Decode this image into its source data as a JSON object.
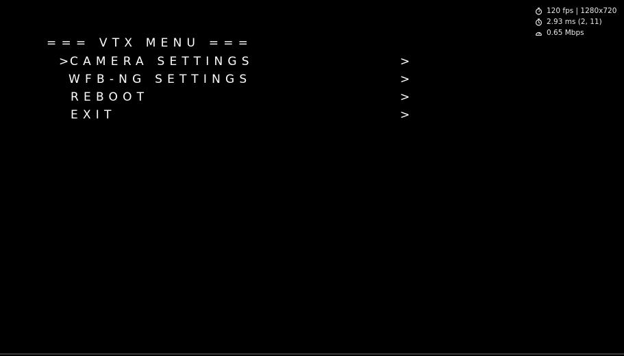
{
  "overlay": {
    "stats": [
      {
        "icon": "fps-gauge-icon",
        "text": "120 fps | 1280x720"
      },
      {
        "icon": "latency-icon",
        "text": "2.93 ms (2, 11)"
      },
      {
        "icon": "bitrate-speedometer-icon",
        "text": "0.65 Mbps"
      }
    ]
  },
  "menu": {
    "title": "=== VTX MENU ===",
    "cursor": ">",
    "selected_index": 0,
    "items": [
      {
        "label": "CAMERA SETTINGS",
        "arrow": ">"
      },
      {
        "label": "WFB-NG SETTINGS",
        "arrow": ">"
      },
      {
        "label": "REBOOT",
        "arrow": ">"
      },
      {
        "label": "EXIT",
        "arrow": ">"
      }
    ]
  },
  "colors": {
    "background": "#000000",
    "text": "#ffffff",
    "stats_text": "#e8e8e8"
  }
}
